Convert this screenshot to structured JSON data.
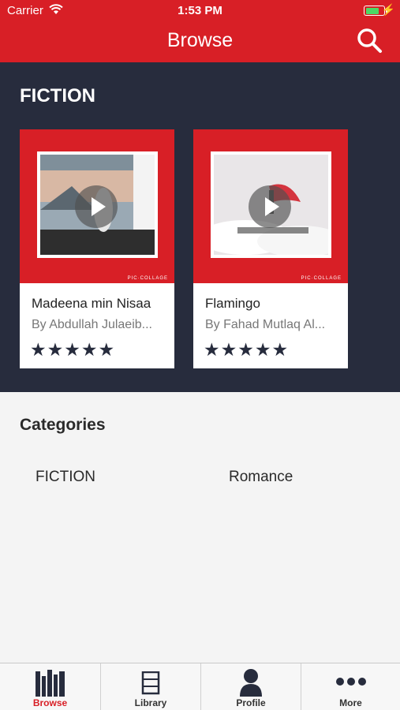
{
  "status_bar": {
    "carrier": "Carrier",
    "time": "1:53 PM",
    "battery_level": 0.8
  },
  "header": {
    "title": "Browse",
    "search_icon": "search-icon"
  },
  "section": {
    "title": "FICTION",
    "books": [
      {
        "title": "Madeena min Nisaa",
        "author": "By Abdullah Julaeib...",
        "rating": 5,
        "rating_stars": "★★★★★",
        "cover_tag": "PIC·COLLAGE",
        "cover_color": "#d81f26"
      },
      {
        "title": "Flamingo",
        "author": "By Fahad Mutlaq Al...",
        "rating": 5,
        "rating_stars": "★★★★★",
        "cover_tag": "PIC·COLLAGE",
        "cover_color": "#d81f26"
      }
    ]
  },
  "categories": {
    "heading": "Categories",
    "items": [
      "FICTION",
      "Romance"
    ]
  },
  "tabbar": {
    "tabs": [
      {
        "label": "Browse",
        "icon": "books-icon",
        "active": true
      },
      {
        "label": "Library",
        "icon": "library-icon",
        "active": false
      },
      {
        "label": "Profile",
        "icon": "profile-icon",
        "active": false
      },
      {
        "label": "More",
        "icon": "more-icon",
        "active": false
      }
    ]
  },
  "colors": {
    "brand_red": "#d81f26",
    "dark_navy": "#272c3d",
    "background": "#f4f4f4"
  }
}
